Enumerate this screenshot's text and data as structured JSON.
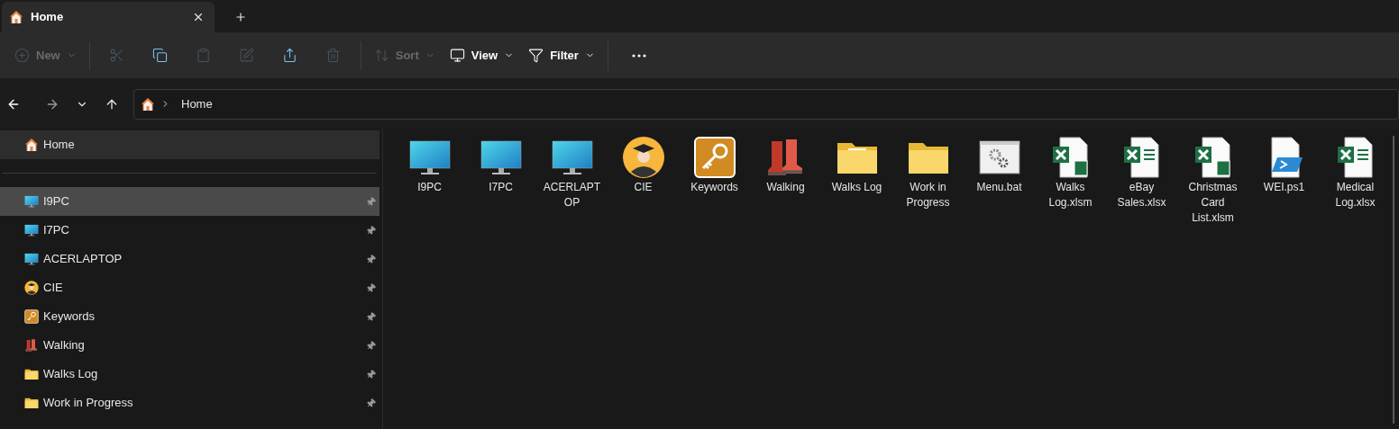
{
  "tabs": [
    {
      "label": "Home",
      "selected": true
    }
  ],
  "toolbar": [
    {
      "kind": "new",
      "label": "New",
      "dropdown": true,
      "disabled": true
    },
    {
      "kind": "cut",
      "disabled": true
    },
    {
      "kind": "copy",
      "disabled": false
    },
    {
      "kind": "paste",
      "disabled": true
    },
    {
      "kind": "rename",
      "disabled": true
    },
    {
      "kind": "share",
      "disabled": false
    },
    {
      "kind": "delete",
      "disabled": true
    },
    {
      "kind": "sort",
      "label": "Sort",
      "dropdown": true,
      "disabled": true
    },
    {
      "kind": "view",
      "label": "View",
      "dropdown": true,
      "disabled": false
    },
    {
      "kind": "filter",
      "label": "Filter",
      "dropdown": true,
      "disabled": false
    },
    {
      "kind": "more",
      "disabled": false
    }
  ],
  "navigation": {
    "back_disabled": false,
    "forward_disabled": true
  },
  "address_bar": {
    "path": [
      "Home"
    ]
  },
  "sidebar": {
    "home": {
      "label": "Home",
      "selected": true
    },
    "items": [
      {
        "label": "I9PC",
        "kind": "monitor",
        "selected": true,
        "pinned": true
      },
      {
        "label": "I7PC",
        "kind": "monitor",
        "selected": false,
        "pinned": true
      },
      {
        "label": "ACERLAPTOP",
        "kind": "monitor",
        "selected": false,
        "pinned": true
      },
      {
        "label": "CIE",
        "kind": "avatar",
        "selected": false,
        "pinned": true
      },
      {
        "label": "Keywords",
        "kind": "key",
        "selected": false,
        "pinned": true
      },
      {
        "label": "Walking",
        "kind": "boots",
        "selected": false,
        "pinned": true
      },
      {
        "label": "Walks Log",
        "kind": "folder",
        "selected": false,
        "pinned": true
      },
      {
        "label": "Work in Progress",
        "kind": "folder",
        "selected": false,
        "pinned": true
      }
    ]
  },
  "files": [
    {
      "label": "I9PC",
      "kind": "monitor"
    },
    {
      "label": "I7PC",
      "kind": "monitor"
    },
    {
      "label": "ACERLAPTOP",
      "kind": "monitor"
    },
    {
      "label": "CIE",
      "kind": "avatar"
    },
    {
      "label": "Keywords",
      "kind": "key"
    },
    {
      "label": "Walking",
      "kind": "boots"
    },
    {
      "label": "Walks Log",
      "kind": "folder-sheet"
    },
    {
      "label": "Work in Progress",
      "kind": "folder"
    },
    {
      "label": "Menu.bat",
      "kind": "batch"
    },
    {
      "label": "Walks Log.xlsm",
      "kind": "excel-macro"
    },
    {
      "label": "eBay Sales.xlsx",
      "kind": "excel"
    },
    {
      "label": "Christmas Card List.xlsm",
      "kind": "excel-macro"
    },
    {
      "label": "WEI.ps1",
      "kind": "powershell"
    },
    {
      "label": "Medical Log.xlsx",
      "kind": "excel"
    }
  ]
}
